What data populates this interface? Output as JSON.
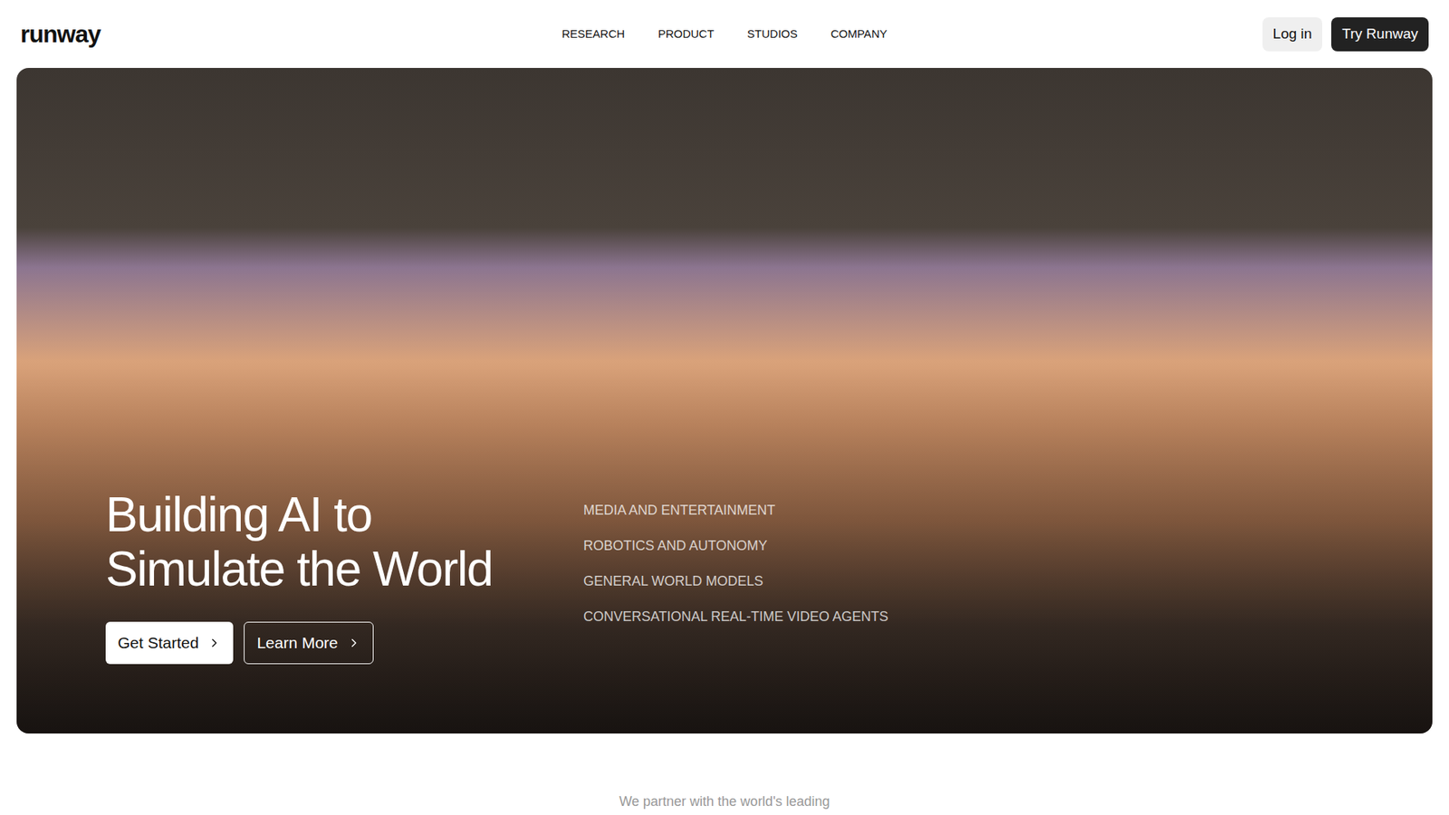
{
  "header": {
    "logo": "runway",
    "nav": [
      "RESEARCH",
      "PRODUCT",
      "STUDIOS",
      "COMPANY"
    ],
    "login": "Log in",
    "cta": "Try Runway"
  },
  "hero": {
    "title_lines": [
      "Building AI to",
      "Simulate the World"
    ],
    "buttons": [
      {
        "label": "Get Started",
        "kind": "primary"
      },
      {
        "label": "Learn More",
        "kind": "outline"
      }
    ],
    "topics": [
      "MEDIA AND ENTERTAINMENT",
      "ROBOTICS AND AUTONOMY",
      "GENERAL WORLD MODELS",
      "CONVERSATIONAL REAL-TIME VIDEO AGENTS"
    ]
  },
  "partners": {
    "text": "We partner with the world's leading"
  }
}
